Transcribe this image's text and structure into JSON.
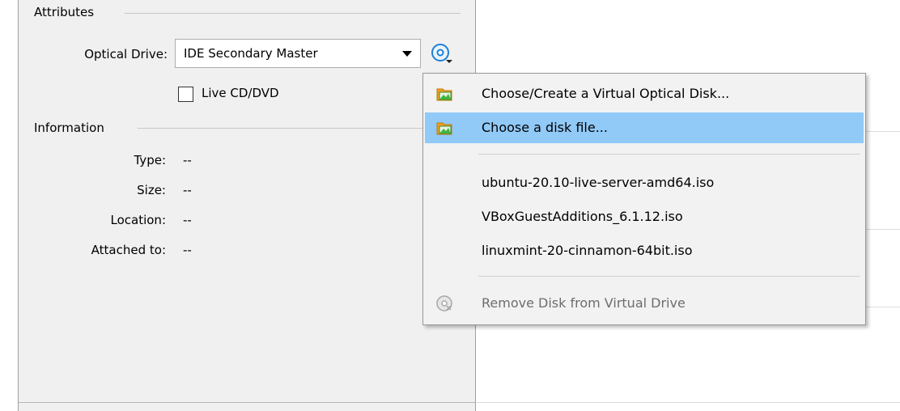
{
  "attributes": {
    "group_title": "Attributes",
    "optical_drive_label": "Optical Drive:",
    "optical_drive_value": "IDE Secondary Master",
    "live_cd_label": "Live CD/DVD",
    "live_cd_checked": false
  },
  "information": {
    "group_title": "Information",
    "rows": [
      {
        "label": "Type:",
        "value": "--"
      },
      {
        "label": "Size:",
        "value": "--"
      },
      {
        "label": "Location:",
        "value": "--"
      },
      {
        "label": "Attached to:",
        "value": "--"
      }
    ]
  },
  "menu": {
    "items": [
      {
        "label": "Choose/Create a Virtual Optical Disk...",
        "icon": "folder-image-icon"
      },
      {
        "label": "Choose a disk file...",
        "icon": "folder-image-icon",
        "selected": true
      },
      {
        "label": "ubuntu-20.10-live-server-amd64.iso"
      },
      {
        "label": "VBoxGuestAdditions_6.1.12.iso"
      },
      {
        "label": "linuxmint-20-cinnamon-64bit.iso"
      },
      {
        "label": "Remove Disk from Virtual Drive",
        "icon": "remove-disc-icon",
        "disabled": true
      }
    ]
  },
  "colors": {
    "panel_bg": "#f0f0f0",
    "menu_bg": "#f2f2f2",
    "menu_selection": "#91c9f7",
    "disc_icon_blue": "#1e7fd6",
    "folder_orange": "#f0a020",
    "image_green": "#3fb540"
  }
}
